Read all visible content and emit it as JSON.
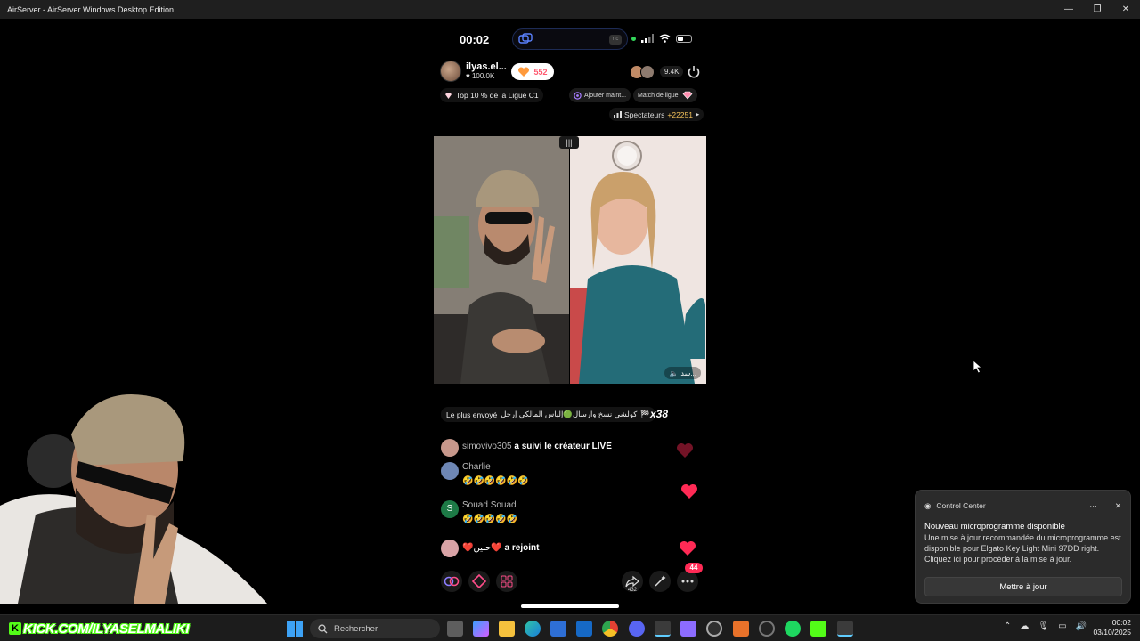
{
  "window": {
    "title": "AirServer - AirServer Windows Desktop Edition",
    "minimize": "—",
    "maximize": "❐",
    "close": "✕"
  },
  "phone": {
    "time": "00:02",
    "island_badge": "rtc",
    "host": {
      "name": "ilyas.el...",
      "likes": "100.0K",
      "gift_count": "552"
    },
    "top_viewers_count": "9.4K",
    "league_text": "Top 10 % de la Ligue C1",
    "add_chip": "Ajouter maint...",
    "match_chip": "Match de ligue",
    "spectators": {
      "label": "Spectateurs",
      "count": "+22251"
    },
    "vs_label": "|||",
    "guest_label": "سد...",
    "most_sent": {
      "label": "Le plus envoyé",
      "text": "كولشي نسخ وارسال🟢إلباس المالكي إرحل",
      "multiplier": "x38"
    },
    "comments": [
      {
        "name": "simovivo305",
        "action": "a suivi le créateur LIVE",
        "text": ""
      },
      {
        "name": "Charlie",
        "action": "",
        "text": "🤣🤣🤣🤣🤣🤣"
      },
      {
        "name": "Souad Souad",
        "action": "",
        "text": "🤣🤣🤣🤣🤣",
        "initial": "S"
      },
      {
        "name": "❤️حنين❤️",
        "action": "a rejoint",
        "text": ""
      }
    ],
    "share_count": "432",
    "more_badge": "44"
  },
  "notification": {
    "app": "Control Center",
    "title": "Nouveau microprogramme disponible",
    "body": "Une mise à jour recommandée du microprogramme est disponible pour Elgato Key Light Mini 97DD right. Cliquez ici pour procéder à la mise à jour.",
    "button": "Mettre à jour",
    "more": "···",
    "close": "✕"
  },
  "taskbar": {
    "kick_url": "KICK.COM/ILYASELMALIKI",
    "kick_letter": "K",
    "search_placeholder": "Rechercher",
    "time": "00:02",
    "date": "03/10/2025"
  },
  "colors": {
    "accent_pink": "#ff2a55",
    "kick_green": "#53fc18",
    "windows_blue": "#3da2f5"
  }
}
